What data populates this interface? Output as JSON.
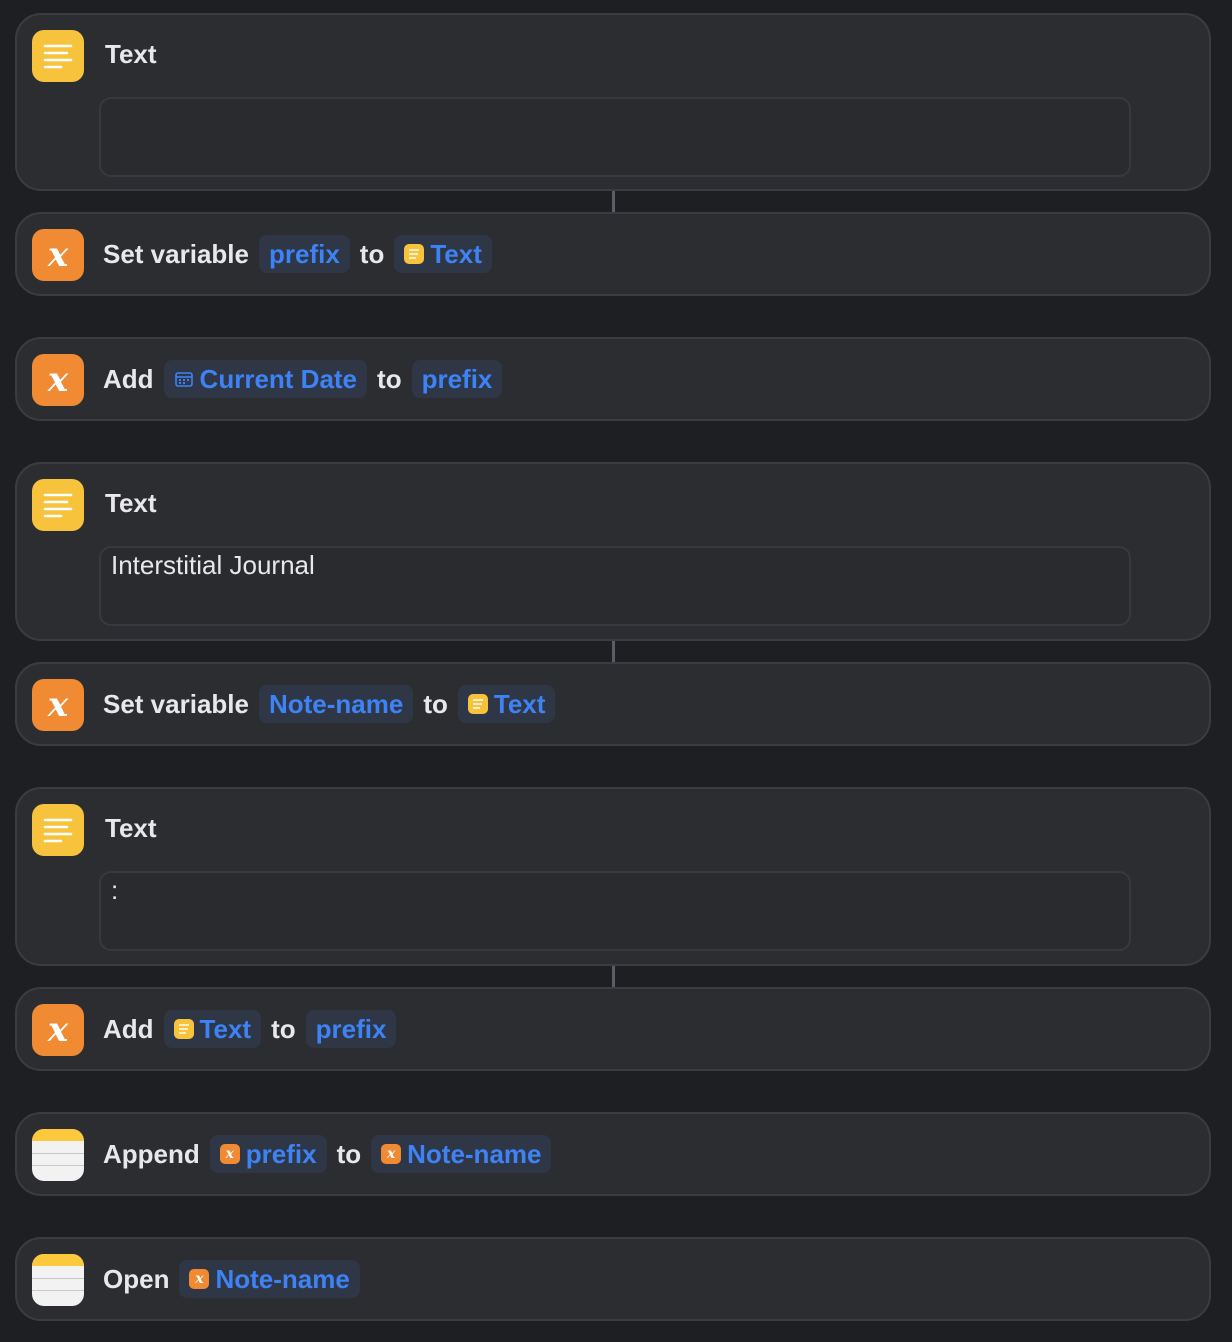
{
  "actions": [
    {
      "type": "text",
      "title": "Text",
      "content": ""
    },
    {
      "type": "set_variable",
      "label": "Set variable",
      "variable": "prefix",
      "connector": "to",
      "input": "Text"
    },
    {
      "type": "add_to_variable",
      "label": "Add",
      "input": "Current Date",
      "connector": "to",
      "variable": "prefix"
    },
    {
      "type": "text",
      "title": "Text",
      "content": "Interstitial Journal"
    },
    {
      "type": "set_variable",
      "label": "Set variable",
      "variable": "Note-name",
      "connector": "to",
      "input": "Text"
    },
    {
      "type": "text",
      "title": "Text",
      "content": ":"
    },
    {
      "type": "add_to_variable",
      "label": "Add",
      "input": "Text",
      "connector": "to",
      "variable": "prefix"
    },
    {
      "type": "append_to_note",
      "label": "Append",
      "input": "prefix",
      "connector": "to",
      "note": "Note-name"
    },
    {
      "type": "open_note",
      "label": "Open",
      "note": "Note-name"
    }
  ],
  "icons": {
    "text": "text-lines-icon",
    "variable": "variable-x-icon",
    "notes": "notes-app-icon",
    "calendar": "calendar-icon"
  },
  "colors": {
    "background": "#1e1f23",
    "card": "#2c2d31",
    "token_text": "#3d83f5",
    "text_icon": "#f7c33c",
    "variable_icon": "#f08a33"
  }
}
